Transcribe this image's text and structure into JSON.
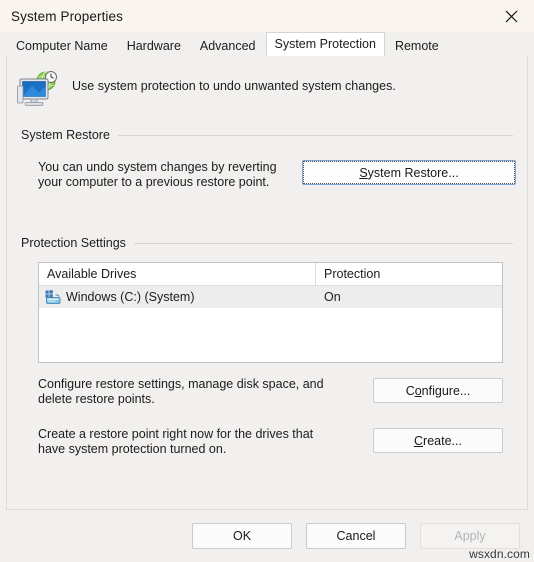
{
  "window": {
    "title": "System Properties",
    "close_icon": "close-icon"
  },
  "tabs": [
    {
      "label": "Computer Name",
      "active": false
    },
    {
      "label": "Hardware",
      "active": false
    },
    {
      "label": "Advanced",
      "active": false
    },
    {
      "label": "System Protection",
      "active": true
    },
    {
      "label": "Remote",
      "active": false
    }
  ],
  "header": {
    "icon": "system-protection-icon",
    "description": "Use system protection to undo unwanted system changes."
  },
  "system_restore": {
    "legend": "System Restore",
    "description_line1": "You can undo system changes by reverting",
    "description_line2": "your computer to a previous restore point.",
    "button_accel": "S",
    "button_rest": "ystem Restore..."
  },
  "protection_settings": {
    "legend": "Protection Settings",
    "columns": [
      "Available Drives",
      "Protection"
    ],
    "rows": [
      {
        "icon": "windows-drive-icon",
        "drive": "Windows (C:) (System)",
        "protection": "On",
        "selected": true
      }
    ],
    "configure": {
      "description_line1": "Configure restore settings, manage disk space, and",
      "description_line2": "delete restore points.",
      "button_pre": "C",
      "button_accel": "o",
      "button_rest": "nfigure..."
    },
    "create": {
      "description_line1": "Create a restore point right now for the drives that",
      "description_line2": "have system protection turned on.",
      "button_accel": "C",
      "button_rest": "reate..."
    }
  },
  "footer": {
    "ok": "OK",
    "cancel": "Cancel",
    "apply": "Apply",
    "apply_disabled": true
  },
  "watermark": "wsxdn.com",
  "colors": {
    "titlebar_bg": "#faf4ef",
    "dialog_bg": "#f2f0ee",
    "active_tab_bg": "#ffffff",
    "default_button_border": "#7aa5d2",
    "listview_bg": "#ffffff",
    "selected_row_bg": "#ededed",
    "text": "#1c1c1c",
    "disabled_text": "#b4b4b4"
  }
}
